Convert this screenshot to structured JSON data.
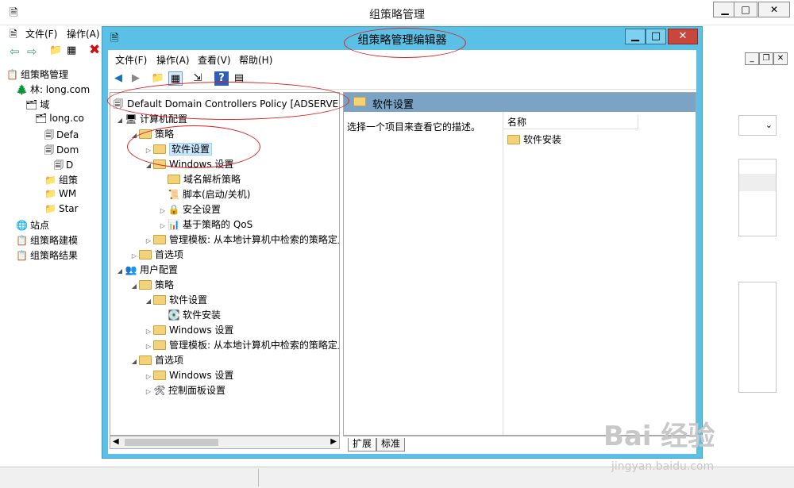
{
  "bg_window": {
    "title": "组策略管理",
    "menu": [
      "文件(F)",
      "操作(A)"
    ],
    "tree": [
      {
        "label": "组策略管理",
        "depth": 0
      },
      {
        "label": "林: long.com",
        "depth": 1
      },
      {
        "label": "域",
        "depth": 2
      },
      {
        "label": "long.co",
        "depth": 3
      },
      {
        "label": "Defa",
        "depth": 4
      },
      {
        "label": "Dom",
        "depth": 4
      },
      {
        "label": "D",
        "depth": 5
      },
      {
        "label": "组策",
        "depth": 4
      },
      {
        "label": "WM",
        "depth": 4
      },
      {
        "label": "Star",
        "depth": 4
      },
      {
        "label": "站点",
        "depth": 1
      },
      {
        "label": "组策略建模",
        "depth": 1
      },
      {
        "label": "组策略结果",
        "depth": 1
      }
    ]
  },
  "editor": {
    "title": "组策略管理编辑器",
    "menu": [
      "文件(F)",
      "操作(A)",
      "查看(V)",
      "帮助(H)"
    ],
    "root_label": "Default Domain Controllers Policy [ADSERVER.LC",
    "tree": [
      {
        "label": "计算机配置",
        "depth": 0,
        "toggle": "open",
        "icon": "computer-icon"
      },
      {
        "label": "策略",
        "depth": 1,
        "toggle": "open",
        "icon": "folder-icon"
      },
      {
        "label": "软件设置",
        "depth": 2,
        "toggle": "closed",
        "icon": "folder-icon",
        "selected": true
      },
      {
        "label": "Windows 设置",
        "depth": 2,
        "toggle": "open",
        "icon": "folder-icon"
      },
      {
        "label": "域名解析策略",
        "depth": 3,
        "toggle": "",
        "icon": "folder-icon"
      },
      {
        "label": "脚本(启动/关机)",
        "depth": 3,
        "toggle": "",
        "icon": "script-icon"
      },
      {
        "label": "安全设置",
        "depth": 3,
        "toggle": "closed",
        "icon": "security-icon"
      },
      {
        "label": "基于策略的 QoS",
        "depth": 3,
        "toggle": "closed",
        "icon": "chart-icon"
      },
      {
        "label": "管理模板: 从本地计算机中检索的策略定义",
        "depth": 2,
        "toggle": "closed",
        "icon": "folder-icon"
      },
      {
        "label": "首选项",
        "depth": 1,
        "toggle": "closed",
        "icon": "folder-icon"
      },
      {
        "label": "用户配置",
        "depth": 0,
        "toggle": "open",
        "icon": "user-icon"
      },
      {
        "label": "策略",
        "depth": 1,
        "toggle": "open",
        "icon": "folder-icon"
      },
      {
        "label": "软件设置",
        "depth": 2,
        "toggle": "open",
        "icon": "folder-icon"
      },
      {
        "label": "软件安装",
        "depth": 3,
        "toggle": "",
        "icon": "install-icon"
      },
      {
        "label": "Windows 设置",
        "depth": 2,
        "toggle": "closed",
        "icon": "folder-icon"
      },
      {
        "label": "管理模板: 从本地计算机中检索的策略定义",
        "depth": 2,
        "toggle": "closed",
        "icon": "folder-icon"
      },
      {
        "label": "首选项",
        "depth": 1,
        "toggle": "open",
        "icon": "folder-icon"
      },
      {
        "label": "Windows 设置",
        "depth": 2,
        "toggle": "closed",
        "icon": "folder-icon"
      },
      {
        "label": "控制面板设置",
        "depth": 2,
        "toggle": "closed",
        "icon": "control-panel-icon"
      }
    ],
    "right": {
      "header": "软件设置",
      "description": "选择一个项目来查看它的描述。",
      "column_name": "名称",
      "items": [
        "软件安装"
      ]
    },
    "tabs": [
      "扩展",
      "标准"
    ]
  },
  "watermark": "Bai 经验",
  "watermark_url": "jingyan.baidu.com",
  "colors": {
    "accent": "#5bc0e6",
    "header": "#7aa3c5",
    "annotation": "#e02020"
  }
}
